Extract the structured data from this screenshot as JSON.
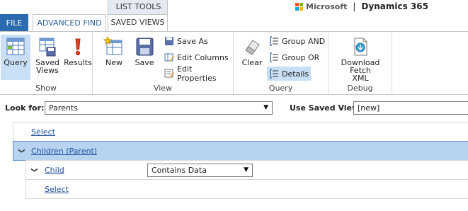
{
  "tabs": {
    "file": "FILE",
    "advanced_find": "ADVANCED FIND",
    "context_group": "LIST TOOLS",
    "saved_views": "SAVED VIEWS"
  },
  "brand": {
    "microsoft": "Microsoft",
    "separator": "|",
    "product": "Dynamics 365"
  },
  "ribbon": {
    "show": {
      "label": "Show",
      "query": "Query",
      "saved_views_line1": "Saved",
      "saved_views_line2": "Views",
      "results": "Results"
    },
    "view": {
      "label": "View",
      "new": "New",
      "save": "Save",
      "save_as": "Save As",
      "edit_columns": "Edit Columns",
      "edit_properties": "Edit Properties"
    },
    "query": {
      "label": "Query",
      "clear": "Clear",
      "group_and": "Group AND",
      "group_or": "Group OR",
      "details": "Details"
    },
    "debug": {
      "label": "Debug",
      "download_line1": "Download Fetch",
      "download_line2": "XML"
    }
  },
  "look_for": {
    "label": "Look for:",
    "value": "Parents"
  },
  "saved_view": {
    "label": "Use Saved View:",
    "value": "[new]"
  },
  "query_rows": {
    "select_top": "Select",
    "relationship": "Children (Parent)",
    "field": "Child",
    "operator": "Contains Data",
    "select_nested": "Select"
  },
  "colors": {
    "file_tab": "#2b6cb0",
    "selected_button": "#c9dff5",
    "highlight_row": "#b7d3f0",
    "link": "#1f4e9c"
  }
}
